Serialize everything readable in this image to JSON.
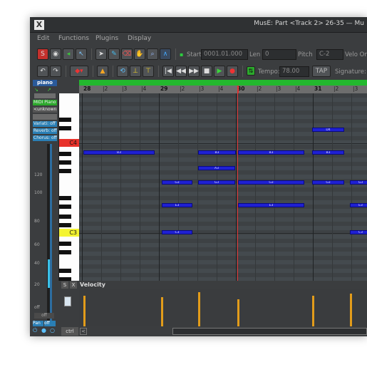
{
  "window": {
    "title": "MusE: Part <Track 2> 26-35 — Mu",
    "bg": "#3b3d3f"
  },
  "menu": [
    "Edit",
    "Functions",
    "Plugins",
    "Display"
  ],
  "toolbar": {
    "start_label": "Start",
    "start_value": "0001.01.000",
    "len_label": "Len",
    "len_value": "0",
    "pitch_label": "Pitch",
    "pitch_value": "C-2",
    "velo_label": "Velo On",
    "tempo_label": "Tempo:",
    "tempo_value": "78.00",
    "tap_label": "TAP",
    "signature_label": "Signature:"
  },
  "left_panel": {
    "instrument_tab": "piano",
    "midi_label": "MIDI Piano",
    "unknown_label": "<unknown>",
    "variation_label": "Variati: off",
    "reverb_label": "Reverb: off",
    "chorus_label": "Chorus: off",
    "pan_label": "Pan",
    "pan_value": "off",
    "off_label": "off",
    "scale_marks": [
      "120",
      "100",
      "80",
      "60",
      "40",
      "20",
      "off"
    ]
  },
  "piano_keys": {
    "c4_label": "C4",
    "c3_label": "C3",
    "c4_color": "#e8322b",
    "c3_color": "#f4f431"
  },
  "ruler": {
    "marks": [
      {
        "text": "28",
        "major": true
      },
      {
        "text": "|2",
        "major": false
      },
      {
        "text": "|3",
        "major": false
      },
      {
        "text": "|4",
        "major": false
      },
      {
        "text": "29",
        "major": true
      },
      {
        "text": "|2",
        "major": false
      },
      {
        "text": "|3",
        "major": false
      },
      {
        "text": "|4",
        "major": false
      },
      {
        "text": "30",
        "major": true
      },
      {
        "text": "|2",
        "major": false
      },
      {
        "text": "|3",
        "major": false
      },
      {
        "text": "|4",
        "major": false
      },
      {
        "text": "31",
        "major": true
      },
      {
        "text": "|2",
        "major": false
      },
      {
        "text": "|3",
        "major": false
      }
    ]
  },
  "notes": [
    {
      "label": "D4"
    },
    {
      "label": "B3"
    },
    {
      "label": "B3"
    },
    {
      "label": "B3"
    },
    {
      "label": "B3"
    },
    {
      "label": "A3"
    },
    {
      "label": "G3"
    },
    {
      "label": "G3"
    },
    {
      "label": "G3"
    },
    {
      "label": "G3"
    },
    {
      "label": "G3"
    },
    {
      "label": "E3"
    },
    {
      "label": "E3"
    },
    {
      "label": "E3"
    },
    {
      "label": "C3"
    },
    {
      "label": "C3"
    }
  ],
  "velocity": {
    "header_s": "S",
    "header_x": "X",
    "label": "Velocity",
    "bars": [
      0.9,
      0.85,
      1.0,
      0.8,
      0.9,
      0.95
    ],
    "color": "#e29c1a"
  },
  "bottom": {
    "ctrl_label": "ctrl"
  },
  "colors": {
    "note_fill": "#1f20d3",
    "grid_bg": "#3d4144",
    "playhead": "#e0302f",
    "ruler_bg": "#6e6e6e",
    "green_strip": "#23b82e"
  }
}
